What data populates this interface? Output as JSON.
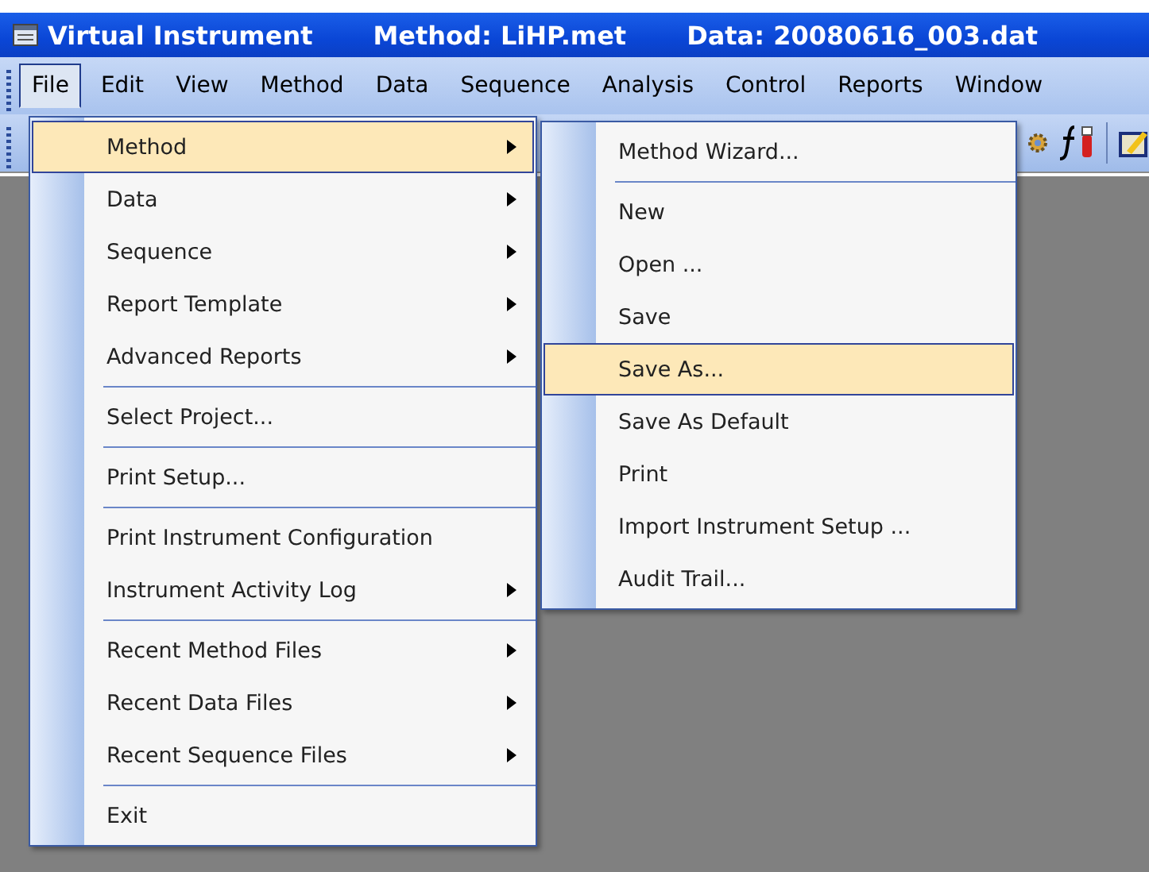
{
  "title_bar": {
    "title": "Virtual Instrument",
    "method": "Method: LiHP.met",
    "data": "Data: 20080616_003.dat"
  },
  "menu_bar": [
    {
      "label": "File",
      "selected": true
    },
    {
      "label": "Edit",
      "selected": false
    },
    {
      "label": "View",
      "selected": false
    },
    {
      "label": "Method",
      "selected": false
    },
    {
      "label": "Data",
      "selected": false
    },
    {
      "label": "Sequence",
      "selected": false
    },
    {
      "label": "Analysis",
      "selected": false
    },
    {
      "label": "Control",
      "selected": false
    },
    {
      "label": "Reports",
      "selected": false
    },
    {
      "label": "Window",
      "selected": false
    }
  ],
  "file_menu": [
    {
      "kind": "item",
      "label": "Method",
      "submenu": true,
      "selected": true
    },
    {
      "kind": "item",
      "label": "Data",
      "submenu": true,
      "selected": false
    },
    {
      "kind": "item",
      "label": "Sequence",
      "submenu": true,
      "selected": false
    },
    {
      "kind": "item",
      "label": "Report Template",
      "submenu": true,
      "selected": false
    },
    {
      "kind": "item",
      "label": "Advanced Reports",
      "submenu": true,
      "selected": false
    },
    {
      "kind": "separator"
    },
    {
      "kind": "item",
      "label": "Select Project...",
      "submenu": false,
      "selected": false
    },
    {
      "kind": "separator"
    },
    {
      "kind": "item",
      "label": "Print Setup...",
      "submenu": false,
      "selected": false
    },
    {
      "kind": "separator"
    },
    {
      "kind": "item",
      "label": "Print Instrument Configuration",
      "submenu": false,
      "selected": false
    },
    {
      "kind": "item",
      "label": "Instrument Activity Log",
      "submenu": true,
      "selected": false
    },
    {
      "kind": "separator"
    },
    {
      "kind": "item",
      "label": "Recent Method Files",
      "submenu": true,
      "selected": false
    },
    {
      "kind": "item",
      "label": "Recent Data Files",
      "submenu": true,
      "selected": false
    },
    {
      "kind": "item",
      "label": "Recent Sequence Files",
      "submenu": true,
      "selected": false
    },
    {
      "kind": "separator"
    },
    {
      "kind": "item",
      "label": "Exit",
      "submenu": false,
      "selected": false
    }
  ],
  "method_submenu": [
    {
      "kind": "item",
      "label": "Method Wizard...",
      "submenu": false,
      "selected": false
    },
    {
      "kind": "separator"
    },
    {
      "kind": "item",
      "label": "New",
      "submenu": false,
      "selected": false
    },
    {
      "kind": "item",
      "label": "Open ...",
      "submenu": false,
      "selected": false
    },
    {
      "kind": "item",
      "label": "Save",
      "submenu": false,
      "selected": false
    },
    {
      "kind": "item",
      "label": "Save As...",
      "submenu": false,
      "selected": true
    },
    {
      "kind": "item",
      "label": "Save As Default",
      "submenu": false,
      "selected": false
    },
    {
      "kind": "item",
      "label": "Print",
      "submenu": false,
      "selected": false
    },
    {
      "kind": "item",
      "label": "Import Instrument Setup ...",
      "submenu": false,
      "selected": false
    },
    {
      "kind": "item",
      "label": "Audit Trail...",
      "submenu": false,
      "selected": false
    }
  ]
}
